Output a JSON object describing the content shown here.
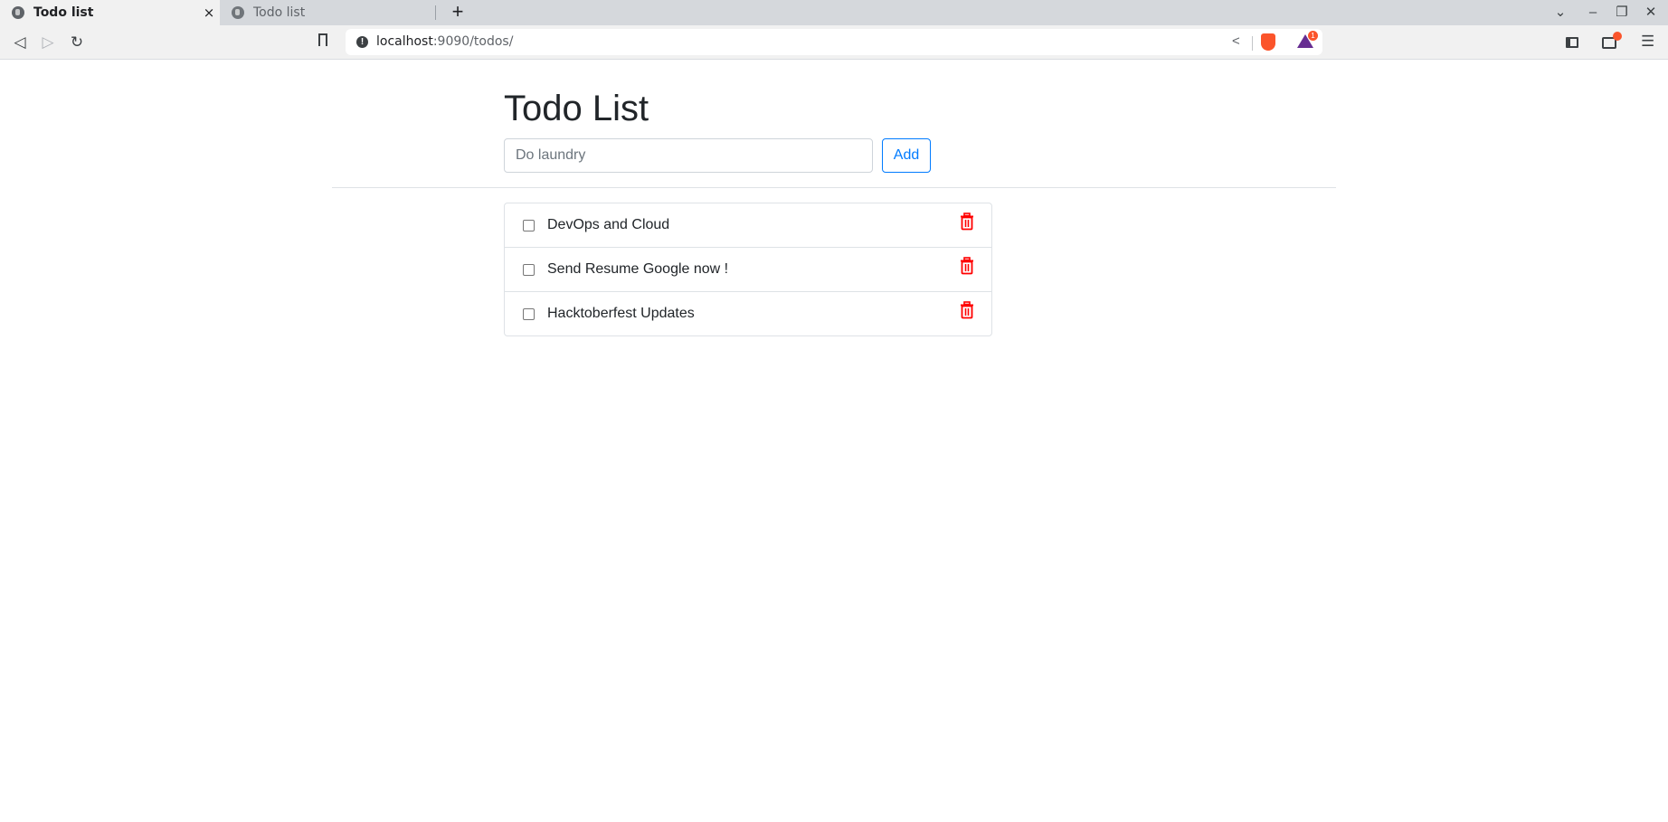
{
  "browser": {
    "tabs": [
      {
        "title": "Todo list",
        "active": true,
        "close_icon": "×"
      },
      {
        "title": "Todo list",
        "active": false
      }
    ],
    "new_tab_icon": "+",
    "window_controls": {
      "dropdown": "⌄",
      "minimize": "–",
      "restore": "❐",
      "close": "✕"
    },
    "nav": {
      "back": "◁",
      "forward": "▷",
      "reload": "↻"
    },
    "bookmark_icon": "🔖",
    "url_host": "localhost",
    "url_rest": ":9090/todos/",
    "share_icon": "<",
    "rewards_badge": "1",
    "menu_icon": "☰"
  },
  "page": {
    "title": "Todo List",
    "input": {
      "value": "",
      "placeholder": "Do laundry"
    },
    "add_label": "Add",
    "todos": [
      {
        "text": "DevOps and Cloud",
        "done": false
      },
      {
        "text": "Send Resume Google now !",
        "done": false
      },
      {
        "text": "Hacktoberfest Updates",
        "done": false
      }
    ],
    "colors": {
      "accent": "#007bff",
      "danger": "#ff0000",
      "text": "#212529"
    }
  }
}
